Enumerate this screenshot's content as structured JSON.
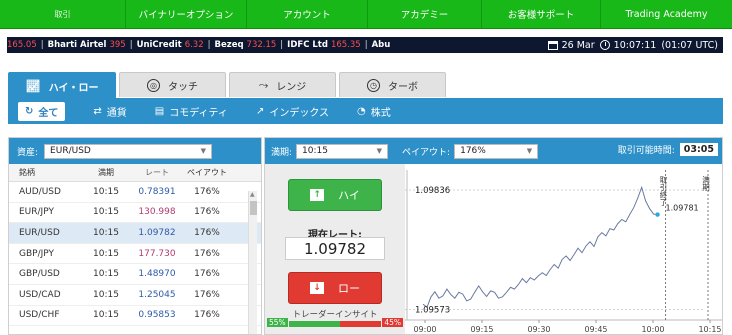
{
  "nav": {
    "items": [
      "取引",
      "バイナリーオプション",
      "アカウント",
      "アカデミー",
      "お客様サポート",
      "Trading Academy"
    ]
  },
  "ticker": {
    "items": [
      {
        "name": "",
        "value": "165.05"
      },
      {
        "name": "Bharti Airtel",
        "value": "395"
      },
      {
        "name": "UniCredit",
        "value": "6.32"
      },
      {
        "name": "Bezeq",
        "value": "732.15"
      },
      {
        "name": "IDFC Ltd",
        "value": "165.35"
      },
      {
        "name": "Abu",
        "value": ""
      }
    ],
    "date": "26 Mar",
    "time": "10:07:11",
    "gmt": "(01:07 UTC)"
  },
  "tabs": [
    {
      "label": "ハイ・ロー",
      "icon": "high-low-chart-icon"
    },
    {
      "label": "タッチ",
      "icon": "touch-target-icon"
    },
    {
      "label": "レンジ",
      "icon": "range-chart-icon"
    },
    {
      "label": "ターボ",
      "icon": "turbo-clock-icon"
    }
  ],
  "filters": [
    {
      "label": "全て",
      "icon": "refresh-icon"
    },
    {
      "label": "通貨",
      "icon": "currency-exchange-icon"
    },
    {
      "label": "コモディティ",
      "icon": "commodity-icon"
    },
    {
      "label": "インデックス",
      "icon": "index-chart-icon"
    },
    {
      "label": "株式",
      "icon": "stock-icon"
    }
  ],
  "left": {
    "asset_label": "資産:",
    "asset_value": "EUR/USD",
    "headers": [
      "銘柄",
      "満期",
      "レート",
      "ペイアウト"
    ],
    "rows": [
      {
        "asset": "AUD/USD",
        "expiry": "10:15",
        "rate": "0.78391",
        "payout": "176%",
        "dir": "up"
      },
      {
        "asset": "EUR/JPY",
        "expiry": "10:15",
        "rate": "130.998",
        "payout": "176%",
        "dir": "down"
      },
      {
        "asset": "EUR/USD",
        "expiry": "10:15",
        "rate": "1.09782",
        "payout": "176%",
        "dir": "up"
      },
      {
        "asset": "GBP/JPY",
        "expiry": "10:15",
        "rate": "177.730",
        "payout": "176%",
        "dir": "down"
      },
      {
        "asset": "GBP/USD",
        "expiry": "10:15",
        "rate": "1.48970",
        "payout": "176%",
        "dir": "up"
      },
      {
        "asset": "USD/CAD",
        "expiry": "10:15",
        "rate": "1.25045",
        "payout": "176%",
        "dir": "up"
      },
      {
        "asset": "USD/CHF",
        "expiry": "10:15",
        "rate": "0.95853",
        "payout": "176%",
        "dir": "up"
      }
    ]
  },
  "right": {
    "expiry_label": "満期:",
    "expiry_value": "10:15",
    "payout_label": "ペイアウト:",
    "payout_value": "176%",
    "time_left_label": "取引可能時間:",
    "time_left_value": "03:05",
    "high_label": "ハイ",
    "low_label": "ロー",
    "current_rate_label": "現在レート:",
    "current_rate": "1.09782",
    "sentiment_label": "トレーダーインサイト",
    "sentiment_high": "55%",
    "sentiment_low": "45%",
    "sentiment_high_fraction": 0.55
  },
  "chart_data": {
    "type": "line",
    "y_max_label": "1.09836",
    "y_min_label": "1.09573",
    "last_label": "1.09781",
    "vline_labels": [
      "取引終了",
      "満期"
    ],
    "x_ticks": [
      "09:00",
      "09:15",
      "09:30",
      "09:45",
      "10:00",
      "10:15"
    ],
    "ylim": [
      1.0955,
      1.0988
    ],
    "values": [
      1.09585,
      1.09578,
      1.09601,
      1.09612,
      1.09598,
      1.09603,
      1.09618,
      1.09606,
      1.09598,
      1.09611,
      1.09607,
      1.09592,
      1.09596,
      1.09611,
      1.09625,
      1.09612,
      1.09602,
      1.09614,
      1.09611,
      1.09598,
      1.09601,
      1.09611,
      1.09622,
      1.09618,
      1.09628,
      1.09641,
      1.09632,
      1.09643,
      1.09638,
      1.09647,
      1.09654,
      1.09648,
      1.09661,
      1.09672,
      1.09664,
      1.09683,
      1.09691,
      1.09681,
      1.09694,
      1.09708,
      1.09698,
      1.09713,
      1.09722,
      1.09712,
      1.09733,
      1.09742,
      1.09735,
      1.09751,
      1.09748,
      1.09762,
      1.09771,
      1.09766,
      1.09782,
      1.09797,
      1.09818,
      1.09842,
      1.09812,
      1.09795,
      1.09783,
      1.09782
    ]
  }
}
